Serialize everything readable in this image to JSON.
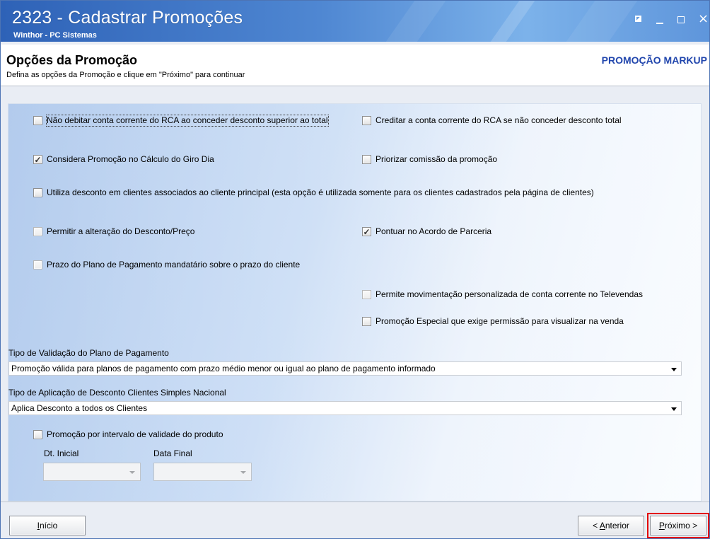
{
  "window": {
    "title": "2323 - Cadastrar Promoções",
    "subtitle": "Winthor - PC Sistemas",
    "controls": {
      "restore_icon": "restore-icon",
      "minimize_icon": "minimize-icon",
      "maximize_icon": "maximize-icon",
      "close_icon": "close-icon",
      "close_glyph": "×"
    }
  },
  "page": {
    "title": "Opções da Promoção",
    "description": "Defina as opções da Promoção e clique em \"Próximo\" para continuar",
    "promotion_type": "PROMOÇÃO MARKUP"
  },
  "options": [
    {
      "key": "nao_debitar_conta",
      "label": "Não debitar conta corrente do RCA ao conceder desconto superior ao total",
      "checked": false,
      "disabled": false,
      "focused": true
    },
    {
      "key": "creditar_conta",
      "label": "Creditar a conta corrente do RCA se não conceder desconto total",
      "checked": false,
      "disabled": false,
      "focused": false
    },
    {
      "key": "considera_giro_dia",
      "label": "Considera Promoção no Cálculo do Giro Dia",
      "checked": true,
      "disabled": false,
      "focused": false
    },
    {
      "key": "priorizar_comissao",
      "label": "Priorizar comissão da promoção",
      "checked": false,
      "disabled": false,
      "focused": false
    },
    {
      "key": "utiliza_desconto_clientes_associados",
      "label": "Utiliza desconto em clientes associados ao cliente principal (esta opção é utilizada somente para os clientes cadastrados pela  página de clientes)",
      "checked": false,
      "disabled": false,
      "focused": false
    },
    {
      "key": "permitir_alteracao",
      "label": "Permitir a alteração do Desconto/Preço",
      "checked": false,
      "disabled": true,
      "focused": false
    },
    {
      "key": "pontuar_acordo",
      "label": "Pontuar no Acordo de Parceria",
      "checked": true,
      "disabled": false,
      "focused": false
    },
    {
      "key": "prazo_mandatario",
      "label": "Prazo do Plano de Pagamento mandatário sobre o prazo do cliente",
      "checked": false,
      "disabled": true,
      "focused": false
    },
    {
      "key": "movimentacao_televendas",
      "label": "Permite movimentação personalizada de conta corrente no Televendas",
      "checked": false,
      "disabled": true,
      "focused": false
    },
    {
      "key": "promocao_especial",
      "label": "Promoção Especial que exige permissão para visualizar na venda",
      "checked": false,
      "disabled": false,
      "focused": false
    }
  ],
  "validation": {
    "label": "Tipo de Validação do Plano de Pagamento",
    "value": "Promoção válida para planos de pagamento com prazo médio menor ou igual ao plano de pagamento informado"
  },
  "discount_application": {
    "label": "Tipo de Aplicação de Desconto Clientes Simples Nacional",
    "value": "Aplica Desconto a todos os Clientes"
  },
  "product_validity": {
    "label": "Promoção por intervalo de validade do produto",
    "checked": false,
    "start_label": "Dt. Inicial",
    "end_label": "Data Final",
    "start_value": "",
    "end_value": ""
  },
  "footer": {
    "start_button": {
      "label": "Início",
      "underlined_letter": "I",
      "rest": "nício"
    },
    "previous_button": {
      "label": "< Anterior",
      "prefix": "< ",
      "underlined_letter": "A",
      "rest": "nterior"
    },
    "next_button": {
      "label": "Próximo >",
      "underlined_letter": "P",
      "rest": "róximo >",
      "highlight_color": "#e30000"
    }
  },
  "colors": {
    "title_bar": "#3f78c8",
    "promotion_type": "#2146ad",
    "panel_gradient_start": "#aec8ec",
    "panel_gradient_end": "#f7fbff",
    "next_highlight": "#e30000"
  }
}
